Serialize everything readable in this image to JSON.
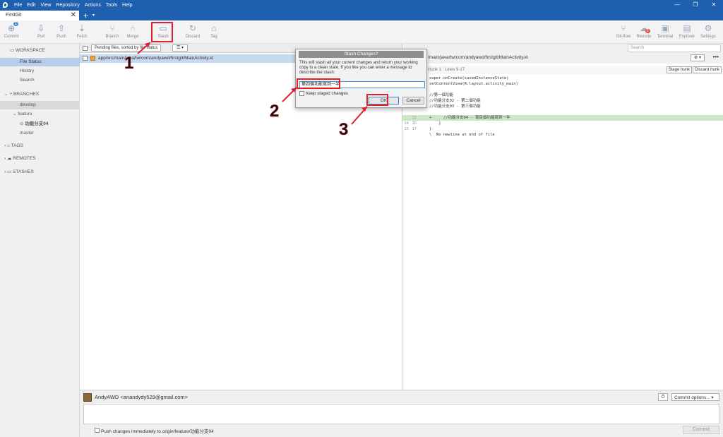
{
  "menu": [
    "File",
    "Edit",
    "View",
    "Repository",
    "Actions",
    "Tools",
    "Help"
  ],
  "window_controls": [
    "—",
    "❐",
    "✕"
  ],
  "tab": {
    "label": "FirstGit",
    "close": "✕",
    "plus": "+",
    "dropdown": "▾"
  },
  "toolbar": {
    "left": [
      {
        "label": "Commit",
        "icon": "commit-icon",
        "badge": "1"
      },
      {
        "label": "Pull",
        "icon": "pull-icon"
      },
      {
        "label": "Push",
        "icon": "push-icon"
      },
      {
        "label": "Fetch",
        "icon": "fetch-icon"
      },
      {
        "label": "Branch",
        "icon": "branch-icon"
      },
      {
        "label": "Merge",
        "icon": "merge-icon"
      },
      {
        "label": "Stash",
        "icon": "stash-icon"
      },
      {
        "label": "Discard",
        "icon": "discard-icon"
      },
      {
        "label": "Tag",
        "icon": "tag-icon"
      }
    ],
    "right": [
      {
        "label": "Git-flow",
        "icon": "gitflow-icon"
      },
      {
        "label": "Remote",
        "icon": "remote-icon",
        "badge": "1"
      },
      {
        "label": "Terminal",
        "icon": "terminal-icon"
      },
      {
        "label": "Explorer",
        "icon": "explorer-icon"
      },
      {
        "label": "Settings",
        "icon": "settings-icon"
      }
    ]
  },
  "sidebar": {
    "workspace": "WORKSPACE",
    "file_status": "File Status",
    "history": "History",
    "search": "Search",
    "branches": "BRANCHES",
    "develop": "develop",
    "feature": "feature",
    "feature_child": "功能分支04",
    "master": "master",
    "tags": "TAGS",
    "remotes": "REMOTES",
    "stashes": "STASHES"
  },
  "files": {
    "sort_label": "Pending files, sorted by file status",
    "list_btn": "☰ ▾",
    "row_path": "app/src/main/java/tw/com/andyawd/firstgit/MainActivity.kt"
  },
  "diff": {
    "path": "/main/java/tw/com/andyawd/firstgit/MainActivity.kt",
    "hunk_label": "Hunk 1 : Lines 9-17",
    "stage_hunk": "Stage hunk",
    "discard_hunk": "Discard hunk",
    "gear": "⚙ ▾",
    "more": "•••",
    "lines": [
      {
        "n1": "",
        "n2": "",
        "text": "super.onCreate(savedInstanceState)"
      },
      {
        "n1": "",
        "n2": "",
        "text": "setContentView(R.layout.activity_main)"
      },
      {
        "n1": "",
        "n2": "",
        "text": ""
      },
      {
        "n1": "",
        "n2": "",
        "text": "//第一個功能"
      },
      {
        "n1": "",
        "n2": "",
        "text": "//功能分支02 - 第二個功能"
      },
      {
        "n1": "",
        "n2": "",
        "text": "//功能分支03 - 第三個功能"
      },
      {
        "n1": "",
        "n2": "",
        "text": ""
      },
      {
        "n1": "",
        "n2": "15",
        "text": "+     //功能分支04 - 寫目個功能寫到一半",
        "add": true
      },
      {
        "n1": "14",
        "n2": "16",
        "text": "    }"
      },
      {
        "n1": "15",
        "n2": "17",
        "text": "}"
      },
      {
        "n1": "",
        "n2": "",
        "text": "\\  No newline at end of file"
      }
    ]
  },
  "search_placeholder": "Search",
  "commit": {
    "author": "AndyAWD <anandydy529@gmail.com>",
    "options": "Commit options... ▾",
    "clock": "⏱",
    "push_label": "Push changes immediately to origin/feature/功能分支04",
    "button": "Commit"
  },
  "dialog": {
    "title": "Stash Changes?",
    "description": "This will stash all your current changes and return your working copy to a clean state. If you like you can enter a message to describe the stash:",
    "input_value": "第四個功能寫到一半",
    "keep_staged": "Keep staged changes",
    "ok": "OK",
    "cancel": "Cancel"
  },
  "annotations": [
    "1",
    "2",
    "3"
  ],
  "colors": {
    "accent": "#1f5fb0",
    "annotation_red": "#e0202a",
    "added_line": "#cbe8c4"
  }
}
